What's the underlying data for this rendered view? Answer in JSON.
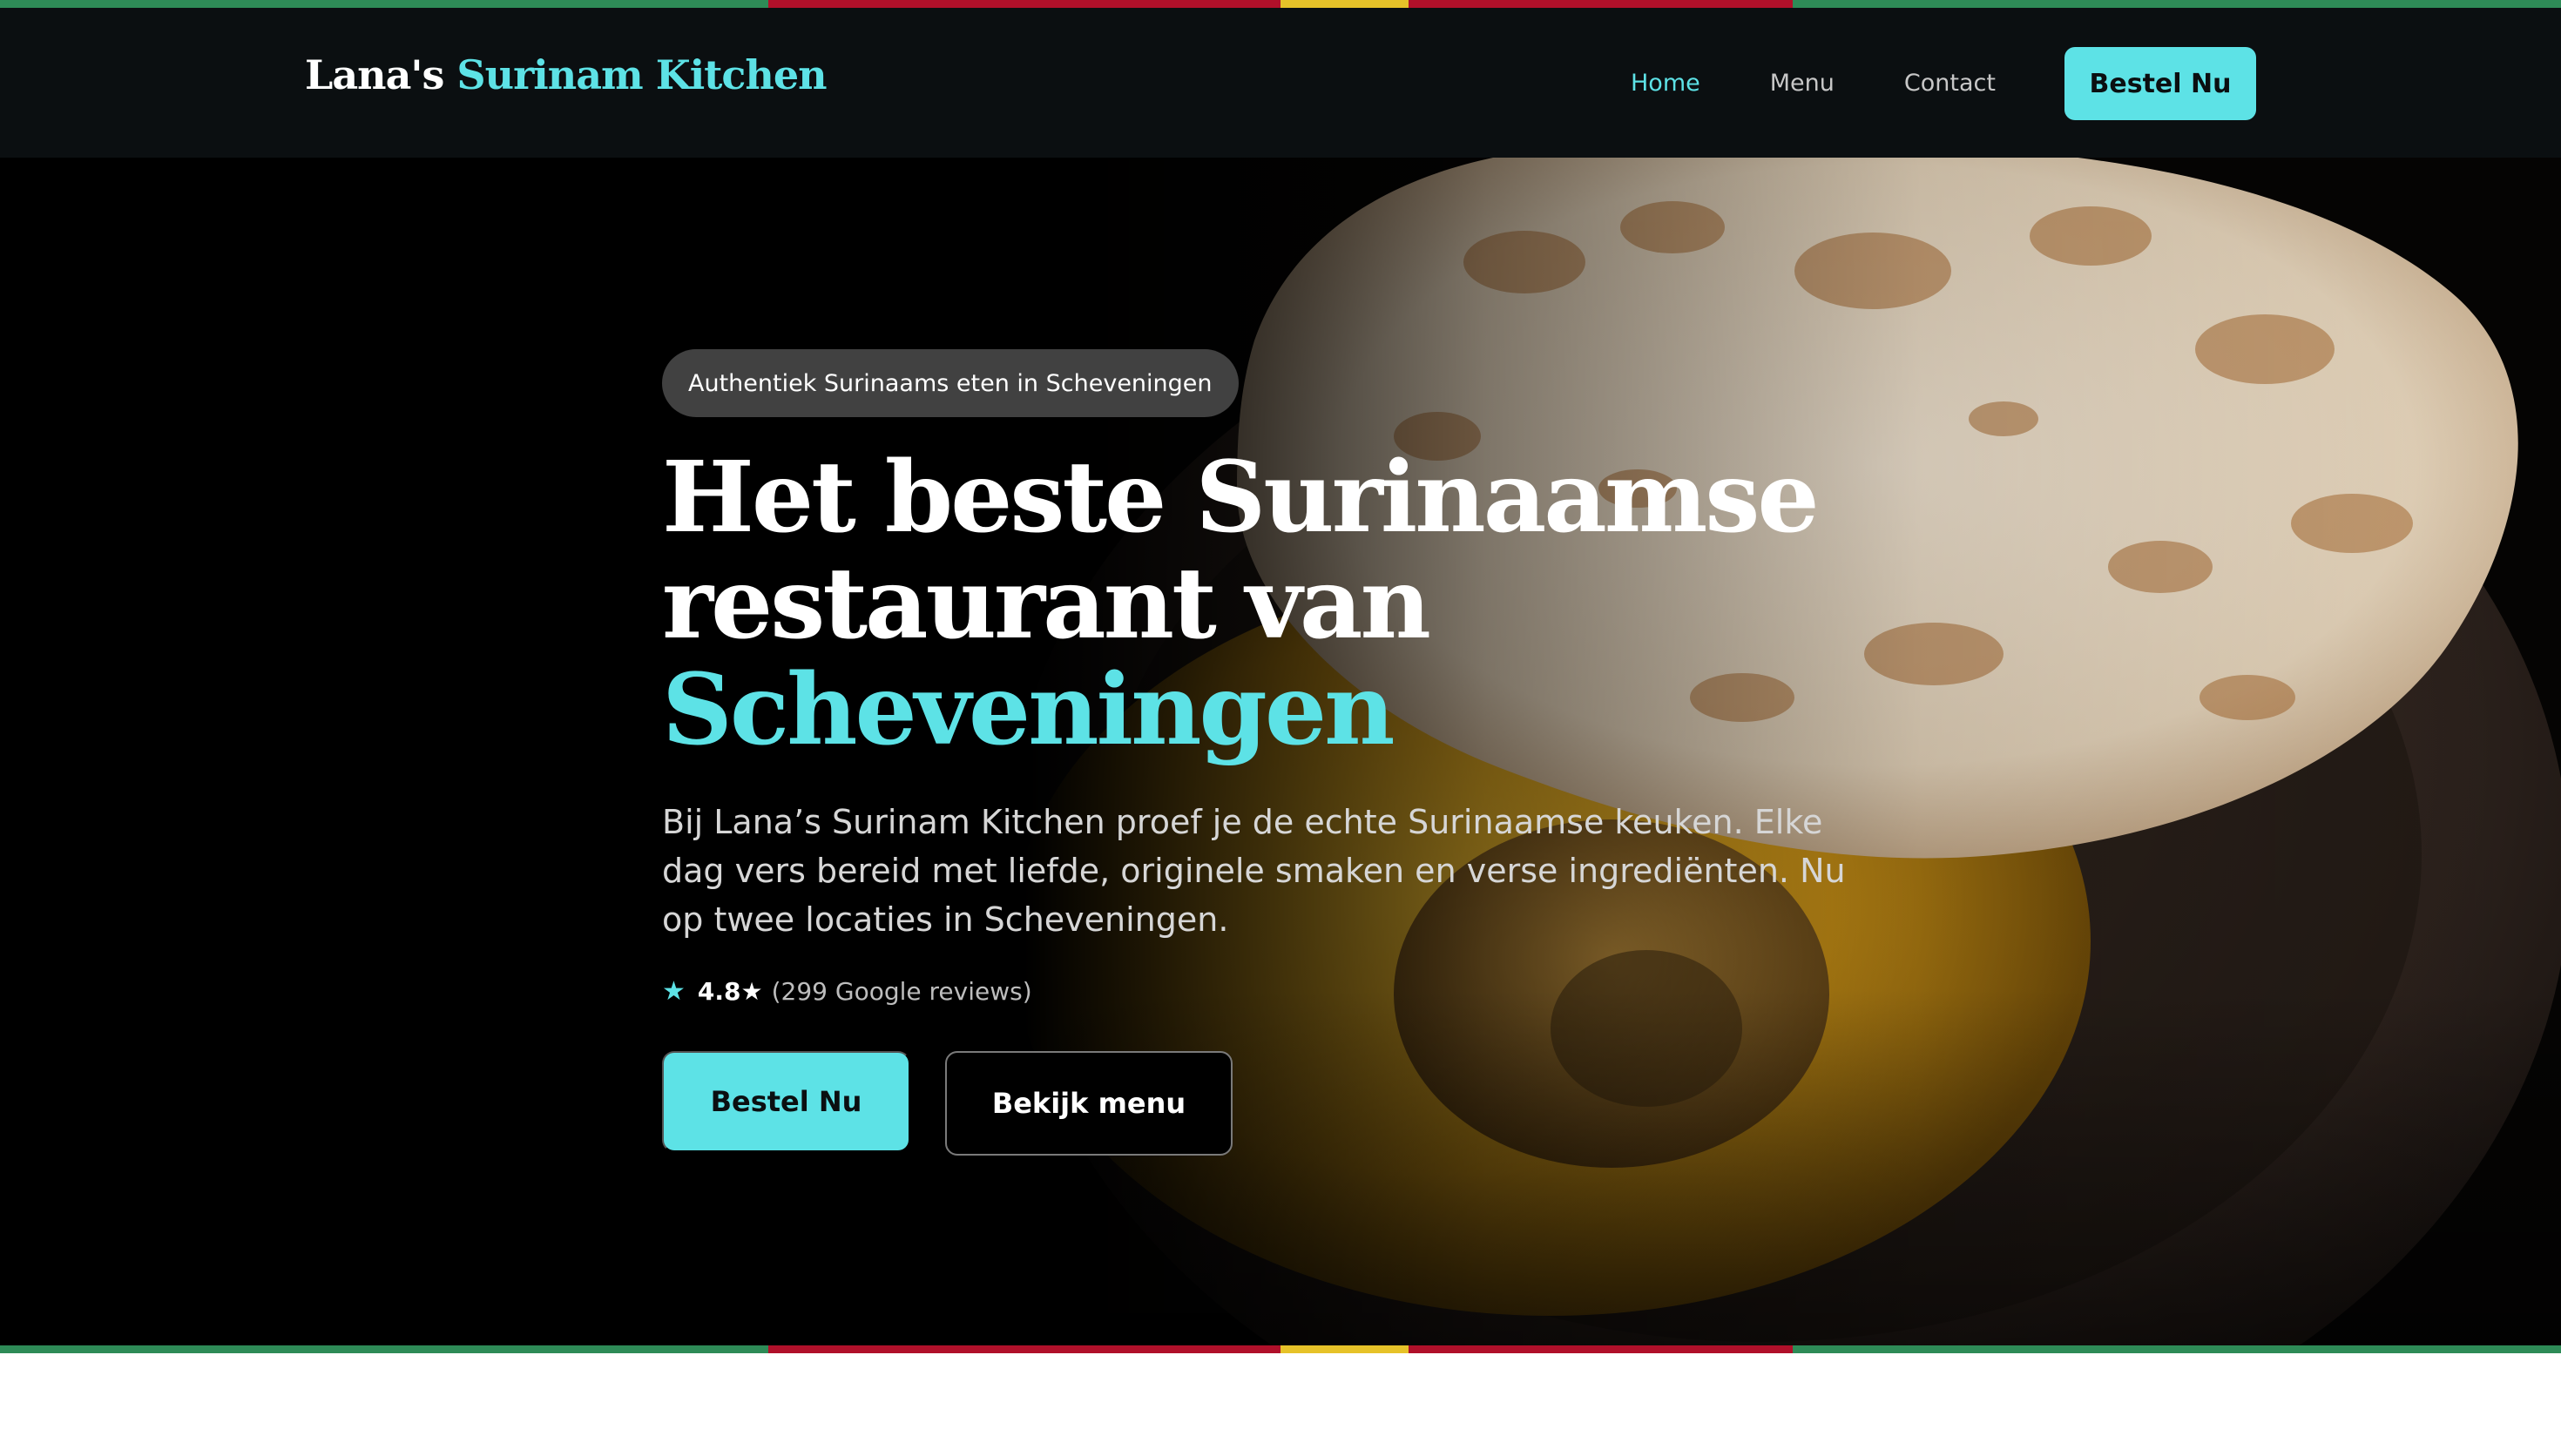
{
  "brand": {
    "name_plain": "Lana's",
    "name_accent": "Surinam Kitchen"
  },
  "nav": {
    "links": [
      {
        "label": "Home",
        "active": true
      },
      {
        "label": "Menu",
        "active": false
      },
      {
        "label": "Contact",
        "active": false
      }
    ],
    "cta_label": "Bestel Nu"
  },
  "hero": {
    "badge": "Authentiek Surinaams eten in Scheveningen",
    "headline_line1": "Het beste Surinaamse",
    "headline_line2": "restaurant van",
    "headline_accent": "Scheveningen",
    "lead": "Bij Lana’s Surinam Kitchen proef je de echte Surinaamse keuken. Elke dag vers bereid met liefde, originele smaken en verse ingrediënten. Nu op twee locaties in Scheveningen.",
    "rating_score": "4.8★",
    "rating_reviews": "(299 Google reviews)",
    "primary_button": "Bestel Nu",
    "secondary_button": "Bekijk menu",
    "image_icon": "roti-curry-photo"
  },
  "colors": {
    "accent": "#5de2e6",
    "nav_background": "#0b0f11",
    "flag_green": "#2e8b57",
    "flag_red": "#b0102a",
    "flag_yellow": "#e6c229"
  }
}
